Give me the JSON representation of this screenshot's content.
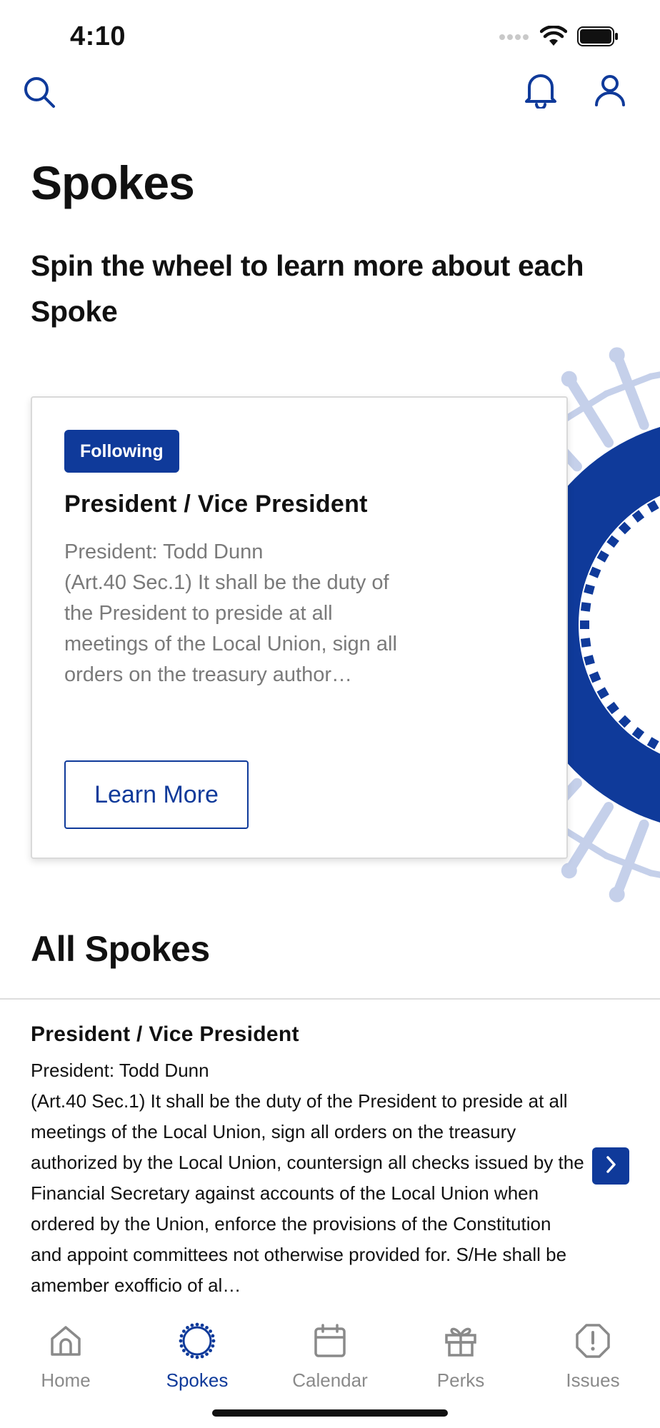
{
  "status": {
    "time": "4:10"
  },
  "header": {
    "search_icon": "search-icon",
    "bell_icon": "bell-icon",
    "profile_icon": "user-icon"
  },
  "page": {
    "title": "Spokes",
    "subtitle": "Spin the wheel to learn more about each Spoke"
  },
  "featured": {
    "badge": "Following",
    "title": "President / Vice President",
    "description": "President: Todd Dunn\n(Art.40 Sec.1) It shall be the duty of the President to preside at all meetings of the Local Union, sign all orders on the treasury author…",
    "button_label": "Learn More"
  },
  "all_spokes": {
    "title": "All Spokes",
    "items": [
      {
        "title": "President / Vice President",
        "description": "President: Todd Dunn\n(Art.40 Sec.1) It shall be the duty of the President to preside at all meetings of the Local Union, sign all orders on the treasury authorized by the Local Union, countersign all checks issued by the Financial Secretary against accounts of the Local Union when ordered by the Union, enforce the provisions of the Constitution and appoint committees not otherwise provided for. S/He shall be amember exofficio of al…"
      }
    ]
  },
  "tabs": [
    {
      "label": "Home",
      "icon": "home-icon",
      "active": false
    },
    {
      "label": "Spokes",
      "icon": "spokes-wheel-icon",
      "active": true
    },
    {
      "label": "Calendar",
      "icon": "calendar-icon",
      "active": false
    },
    {
      "label": "Perks",
      "icon": "gift-icon",
      "active": false
    },
    {
      "label": "Issues",
      "icon": "alert-octagon-icon",
      "active": false
    }
  ],
  "colors": {
    "brand": "#0f3a9a",
    "brand_light": "#c5d0ea",
    "muted_text": "#7a7a7a"
  }
}
